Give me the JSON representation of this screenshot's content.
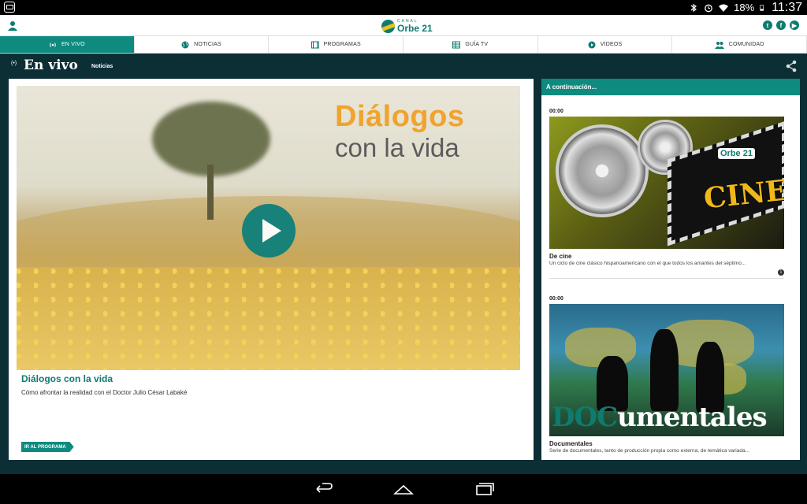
{
  "status_bar": {
    "battery_pct": "18%",
    "time": "11:37",
    "icons": [
      "bluetooth-icon",
      "alarm-icon",
      "wifi-icon",
      "battery-icon"
    ]
  },
  "header": {
    "logo_small": "CANAL",
    "logo_big": "Orbe 21",
    "social": [
      "twitter-icon",
      "facebook-icon",
      "youtube-icon"
    ],
    "accent_color": "#0e8a7f"
  },
  "nav": {
    "items": [
      {
        "label": "EN VIVO",
        "icon": "broadcast-icon"
      },
      {
        "label": "NOTICIAS",
        "icon": "globe-icon"
      },
      {
        "label": "PROGRAMAS",
        "icon": "film-icon"
      },
      {
        "label": "GUÍA TV",
        "icon": "grid-icon"
      },
      {
        "label": "VIDEOS",
        "icon": "play-circle-icon"
      },
      {
        "label": "COMUNIDAD",
        "icon": "people-icon"
      }
    ]
  },
  "page": {
    "live_indicator": "(•)",
    "title": "En vivo",
    "subtitle": "Noticias"
  },
  "player": {
    "overlay_title_1": "Diálogos",
    "overlay_title_2": "con la vida",
    "program_title": "Diálogos con la vida",
    "program_desc": "Cómo afrontar la realidad con el Doctor Julio César Labaké",
    "program_button": "IR AL PROGRAMA"
  },
  "next": {
    "header": "A continuación...",
    "items": [
      {
        "time": "00:00",
        "title": "De cine",
        "desc": "Un ciclo de cine clásico hispanoamericano con el que todos los amantes del séptimo...",
        "image_word": "CINE",
        "image_logo": "Orbe 21"
      },
      {
        "time": "00:00",
        "title": "Documentales",
        "desc": "Serie de documentales, tanto de producción propia como externa, de temática variada...",
        "image_word_a": "DOC",
        "image_word_b": "umentales"
      }
    ]
  }
}
